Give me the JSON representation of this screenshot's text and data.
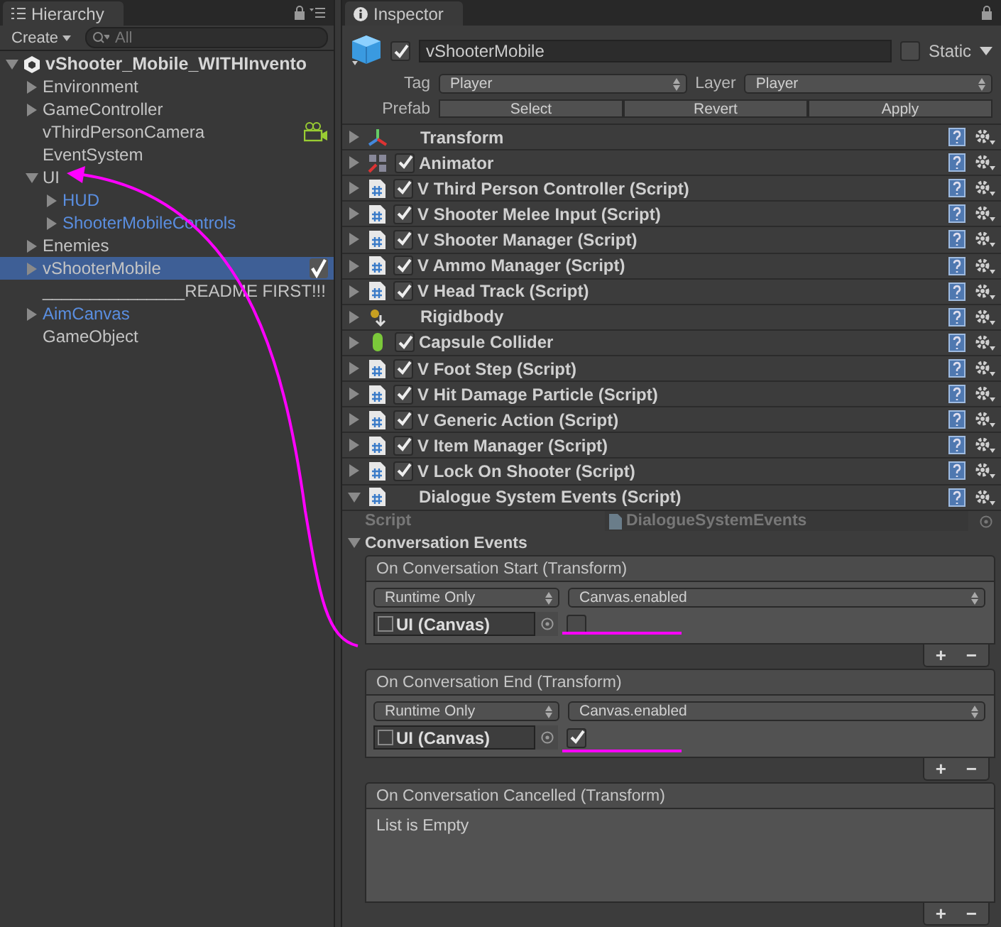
{
  "hierarchy": {
    "title": "Hierarchy",
    "create_button": "Create",
    "search": {
      "placeholder": "All"
    },
    "scene": {
      "label": "vShooter_Mobile_WITHInvento",
      "expanded": true
    },
    "items": [
      {
        "label": "Environment",
        "expanded": false,
        "selected": false,
        "prefab": false
      },
      {
        "label": "GameController",
        "expanded": false,
        "selected": false,
        "prefab": false
      },
      {
        "label": "vThirdPersonCamera",
        "selected": false,
        "prefab": false,
        "kind": "camera"
      },
      {
        "label": "EventSystem",
        "selected": false,
        "prefab": false
      },
      {
        "label": "UI",
        "expanded": true,
        "selected": false,
        "prefab": false,
        "children": [
          {
            "label": "HUD",
            "expanded": false,
            "selected": false,
            "prefab": true
          },
          {
            "label": "ShooterMobileControls",
            "expanded": false,
            "selected": false,
            "prefab": true
          }
        ]
      },
      {
        "label": "Enemies",
        "expanded": false,
        "selected": false,
        "prefab": false
      },
      {
        "label": "vShooterMobile",
        "expanded": false,
        "selected": true,
        "prefab": false,
        "kind": "toggle"
      },
      {
        "label": "_______________README FIRST!!!",
        "selected": false,
        "prefab": false
      },
      {
        "label": "AimCanvas",
        "expanded": false,
        "selected": false,
        "prefab": true
      },
      {
        "label": "GameObject",
        "selected": false,
        "prefab": false
      }
    ]
  },
  "inspector": {
    "title": "Inspector",
    "object": {
      "active": true,
      "name": "vShooterMobile",
      "static_label": "Static",
      "static": false,
      "tag_label": "Tag",
      "tag": "Player",
      "layer_label": "Layer",
      "layer": "Player",
      "prefab_label": "Prefab",
      "prefab_buttons": [
        "Select",
        "Revert",
        "Apply"
      ]
    },
    "components": [
      {
        "name": "Transform",
        "kind": "transform",
        "expanded": false
      },
      {
        "name": "Animator",
        "kind": "animator",
        "expanded": false,
        "enabled": true
      },
      {
        "name": "V Third Person Controller (Script)",
        "kind": "script",
        "expanded": false,
        "enabled": true
      },
      {
        "name": "V Shooter Melee Input (Script)",
        "kind": "script",
        "expanded": false,
        "enabled": true
      },
      {
        "name": "V Shooter Manager (Script)",
        "kind": "script",
        "expanded": false,
        "enabled": true
      },
      {
        "name": "V Ammo Manager (Script)",
        "kind": "script",
        "expanded": false,
        "enabled": true
      },
      {
        "name": "V Head Track (Script)",
        "kind": "script",
        "expanded": false,
        "enabled": true
      },
      {
        "name": "Rigidbody",
        "kind": "rigidbody",
        "expanded": false
      },
      {
        "name": "Capsule Collider",
        "kind": "capsule",
        "expanded": false,
        "enabled": true
      },
      {
        "name": "V Foot Step (Script)",
        "kind": "script",
        "expanded": false,
        "enabled": true
      },
      {
        "name": "V Hit Damage Particle (Script)",
        "kind": "script",
        "expanded": false,
        "enabled": true
      },
      {
        "name": "V Generic Action (Script)",
        "kind": "script",
        "expanded": false,
        "enabled": true
      },
      {
        "name": "V Item Manager (Script)",
        "kind": "script",
        "expanded": false,
        "enabled": true
      },
      {
        "name": "V Lock On Shooter (Script)",
        "kind": "script",
        "expanded": false,
        "enabled": true
      },
      {
        "name": "Dialogue System Events (Script)",
        "kind": "script",
        "expanded": true
      }
    ],
    "script_field": {
      "label": "Script",
      "value": "DialogueSystemEvents"
    },
    "events_section": {
      "label": "Conversation Events",
      "expanded": true,
      "events": [
        {
          "title": "On Conversation Start (Transform)",
          "add": "+",
          "remove": "−",
          "entries": [
            {
              "mode": "Runtime Only",
              "function": "Canvas.enabled",
              "target": "UI (Canvas)",
              "value": false
            }
          ]
        },
        {
          "title": "On Conversation End (Transform)",
          "add": "+",
          "remove": "−",
          "entries": [
            {
              "mode": "Runtime Only",
              "function": "Canvas.enabled",
              "target": "UI (Canvas)",
              "value": true
            }
          ]
        },
        {
          "title": "On Conversation Cancelled (Transform)",
          "add": "+",
          "remove": "−",
          "empty_text": "List is Empty"
        }
      ]
    }
  }
}
